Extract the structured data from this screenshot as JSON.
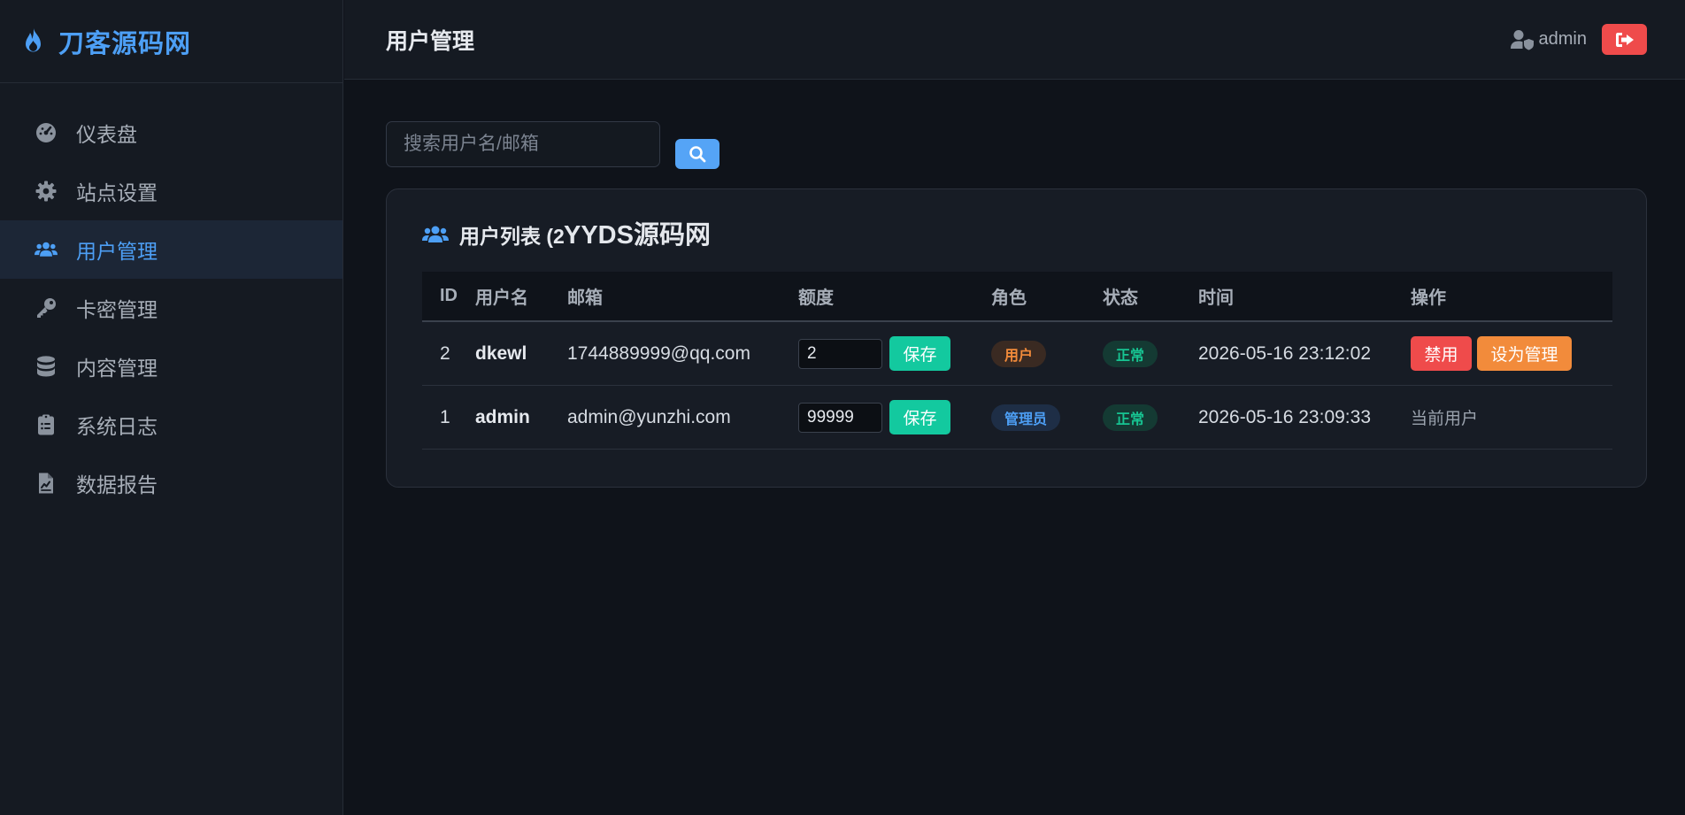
{
  "colors": {
    "accent": "#4d9ff5",
    "danger": "#ef4b4b",
    "success": "#13c99f",
    "warning": "#f28b3b",
    "background": "#0f131a",
    "panel": "#151a22"
  },
  "brand": {
    "title": "刀客源码网",
    "icon": "flame-icon"
  },
  "sidebar": {
    "items": [
      {
        "label": "仪表盘",
        "icon": "dashboard-gauge-icon"
      },
      {
        "label": "站点设置",
        "icon": "gear-icon"
      },
      {
        "label": "用户管理",
        "icon": "users-icon",
        "active": true
      },
      {
        "label": "卡密管理",
        "icon": "key-icon"
      },
      {
        "label": "内容管理",
        "icon": "database-icon"
      },
      {
        "label": "系统日志",
        "icon": "clipboard-icon"
      },
      {
        "label": "数据报告",
        "icon": "file-chart-icon"
      }
    ]
  },
  "header": {
    "title": "用户管理",
    "user_name": "admin",
    "user_icon": "user-shield-icon",
    "logout_icon": "sign-out-icon"
  },
  "search": {
    "placeholder": "搜索用户名/邮箱",
    "value": "",
    "icon": "search-icon"
  },
  "card": {
    "title": "用户列表 (2",
    "icon": "users-icon",
    "watermark": "YYDS源码网"
  },
  "table": {
    "headers": [
      "ID",
      "用户名",
      "邮箱",
      "额度",
      "角色",
      "状态",
      "时间",
      "操作"
    ],
    "rows": [
      {
        "id": "2",
        "username": "dkewl",
        "email": "1744889999@qq.com",
        "quota": "2",
        "save_label": "保存",
        "role": "用户",
        "status": "正常",
        "time": "2026-05-16 23:12:02",
        "actions": {
          "ban": "禁用",
          "make_admin": "设为管理"
        }
      },
      {
        "id": "1",
        "username": "admin",
        "email": "admin@yunzhi.com",
        "quota": "99999",
        "save_label": "保存",
        "role": "管理员",
        "status": "正常",
        "time": "2026-05-16 23:09:33",
        "actions": {
          "current": "当前用户"
        }
      }
    ]
  }
}
